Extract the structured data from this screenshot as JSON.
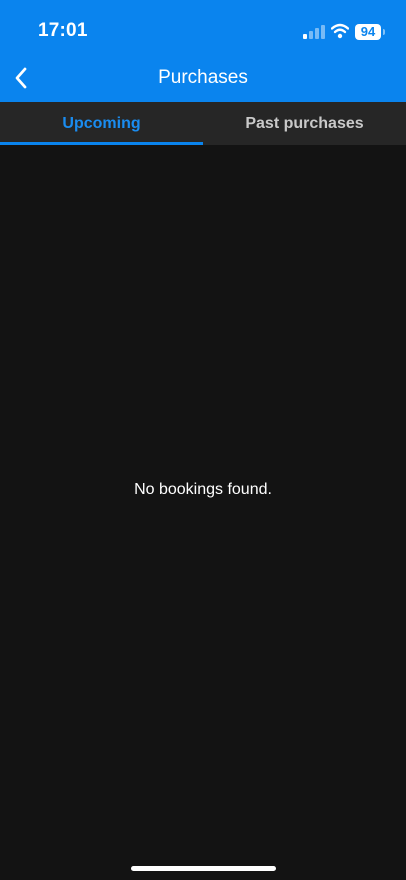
{
  "status_bar": {
    "time": "17:01",
    "battery_level": "94",
    "icons": [
      "signal-icon",
      "wifi-icon",
      "battery-icon"
    ]
  },
  "nav": {
    "title": "Purchases",
    "back_icon": "chevron-left-icon"
  },
  "tabs": [
    {
      "label": "Upcoming",
      "active": true
    },
    {
      "label": "Past purchases",
      "active": false
    }
  ],
  "content": {
    "empty_message": "No bookings found."
  },
  "colors": {
    "accent": "#0A84EE",
    "background": "#131313",
    "tab_bar": "#262626"
  }
}
